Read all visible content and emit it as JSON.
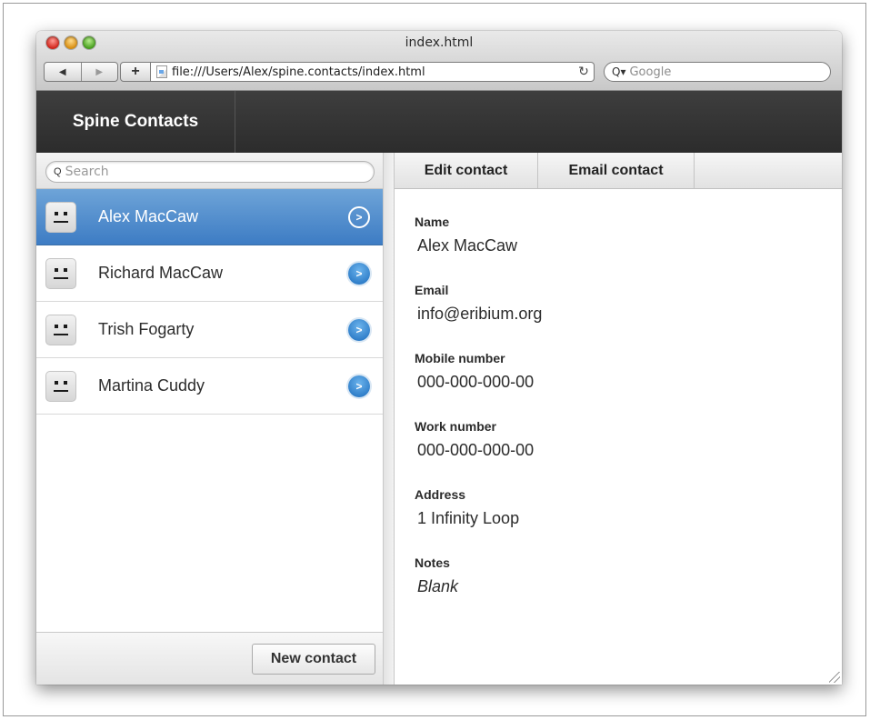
{
  "browser": {
    "window_title": "index.html",
    "back_glyph": "◀",
    "forward_glyph": "▶",
    "add_glyph": "+",
    "url": "file:///Users/Alex/spine.contacts/index.html",
    "reload_glyph": "↻",
    "search_placeholder": "Google",
    "search_icon_glyph": "Q▾"
  },
  "app": {
    "title": "Spine Contacts"
  },
  "sidebar": {
    "search_placeholder": "Search",
    "search_icon_glyph": "Q",
    "contacts": [
      {
        "name": "Alex MacCaw",
        "active": true
      },
      {
        "name": "Richard MacCaw",
        "active": false
      },
      {
        "name": "Trish Fogarty",
        "active": false
      },
      {
        "name": "Martina Cuddy",
        "active": false
      }
    ],
    "arrow_glyph": ">",
    "new_contact_label": "New contact"
  },
  "main": {
    "edit_label": "Edit contact",
    "email_label": "Email contact",
    "fields": [
      {
        "label": "Name",
        "value": "Alex MacCaw"
      },
      {
        "label": "Email",
        "value": "info@eribium.org"
      },
      {
        "label": "Mobile number",
        "value": "000-000-000-00"
      },
      {
        "label": "Work number",
        "value": "000-000-000-00"
      },
      {
        "label": "Address",
        "value": "1 Infinity Loop"
      },
      {
        "label": "Notes",
        "value": "Blank"
      }
    ]
  },
  "colors": {
    "accent": "#3d7cc4",
    "header_bg": "#333333"
  }
}
